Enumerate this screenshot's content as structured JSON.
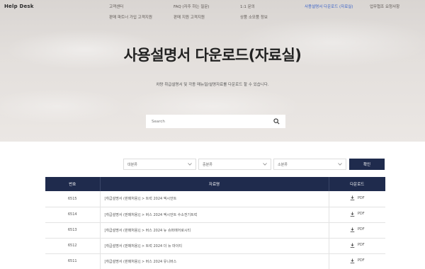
{
  "header": {
    "brand": "Help Desk",
    "nav": [
      {
        "label": "고객센터",
        "active": false
      },
      {
        "label": "FAQ (자주 하는 질문)",
        "active": false
      },
      {
        "label": "1:1 문의",
        "active": false
      },
      {
        "label": "사용설명서 다운로드 (자료실)",
        "active": true
      },
      {
        "label": "업무협조 요청사항",
        "active": false
      },
      {
        "label": "판매 파트너 가입 고객지원",
        "active": false
      },
      {
        "label": "판매 지원 고객지원",
        "active": false
      },
      {
        "label": "상품 소모품 정보",
        "active": false
      }
    ]
  },
  "hero": {
    "title": "사용설명서 다운로드(자료실)",
    "subtitle": "차량 취급설명서 및 각종 매뉴얼/설명자료를 다운로드 할 수 있습니다."
  },
  "search": {
    "placeholder": "Search"
  },
  "filters": [
    {
      "label": "대분류"
    },
    {
      "label": "중분류"
    },
    {
      "label": "소분류"
    }
  ],
  "confirm_label": "확인",
  "table": {
    "headers": [
      "번호",
      "자료명",
      "다운로드"
    ],
    "rows": [
      {
        "no": "6515",
        "title": "[취급설명서 (판매처용)] > 트럭 2024 엑시언트",
        "download": "PDF"
      },
      {
        "no": "6514",
        "title": "[취급설명서 (판매처용)] > 버스 2024 엑시언트 수소전기트럭",
        "download": "PDF"
      },
      {
        "no": "6513",
        "title": "[취급설명서 (판매처용)] > 버스 2024 뉴 슈퍼에어로시티",
        "download": "PDF"
      },
      {
        "no": "6512",
        "title": "[취급설명서 (판매처용)] > 트럭 2024 더 뉴 마이티",
        "download": "PDF"
      },
      {
        "no": "6511",
        "title": "[취급설명서 (판매처용)] > 버스 2024 유니버스",
        "download": "PDF"
      }
    ]
  },
  "colors": {
    "navy": "#1f2b4d",
    "active_link": "#3a62c8"
  }
}
